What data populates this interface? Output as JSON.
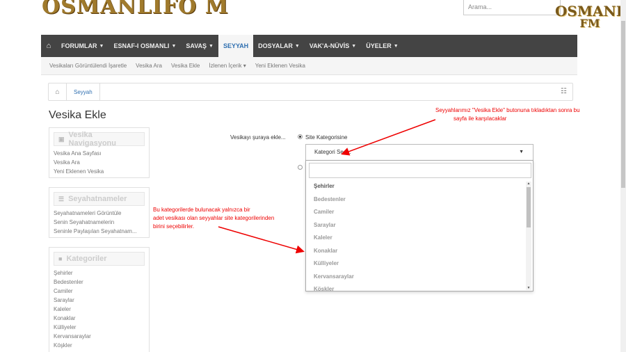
{
  "header": {
    "logo_text": "OSMANLIFO M",
    "search_placeholder": "Arama...",
    "fm_logo_line1": "OSMANLİ",
    "fm_logo_line2": "FM"
  },
  "nav": {
    "items": [
      {
        "label": "FORUMLAR",
        "caret": "▼"
      },
      {
        "label": "ESNAF-I OSMANLI",
        "caret": "▼"
      },
      {
        "label": "SAVAŞ",
        "caret": "▼"
      },
      {
        "label": "SEYYAH",
        "caret": ""
      },
      {
        "label": "DOSYALAR",
        "caret": "▼"
      },
      {
        "label": "VAK'A-NÜVİS",
        "caret": "▼"
      },
      {
        "label": "ÜYELER",
        "caret": "▼"
      }
    ],
    "active_index": 3
  },
  "subnav": {
    "items": [
      "Vesikaları Görüntülendi İşaretle",
      "Vesika Ara",
      "Vesika Ekle",
      "İzlenen İçerik ▾",
      "Yeni Eklenen Vesika"
    ]
  },
  "breadcrumb": {
    "current": "Seyyah"
  },
  "page": {
    "title": "Vesika Ekle"
  },
  "sidebar": {
    "panels": [
      {
        "title": "Vesika Navigasyonu",
        "icon": "compass-icon",
        "links": [
          "Vesika Ana Sayfası",
          "Vesika Ara",
          "Yeni Eklenen Vesika"
        ]
      },
      {
        "title": "Seyahatnameler",
        "icon": "list-icon",
        "links": [
          "Seyahatnameleri Görüntüle",
          "Senin Seyahatnamelerin",
          "Seninle Paylaşılan Seyahatnam..."
        ]
      },
      {
        "title": "Kategoriler",
        "icon": "folder-icon",
        "links": [
          "Şehirler",
          "Bedestenler",
          "Camiler",
          "Saraylar",
          "Kaleler",
          "Konaklar",
          "Külliyeler",
          "Kervansaraylar",
          "Köşkler"
        ]
      }
    ]
  },
  "form": {
    "label": "Vesikayı şuraya ekle...",
    "radio_label": "Site Kategorisine",
    "select_value": "Kategori Seç...",
    "options": [
      "Şehirler",
      "Bedestenler",
      "Camiler",
      "Saraylar",
      "Kaleler",
      "Konaklar",
      "Külliyeler",
      "Kervansaraylar",
      "Köşkler"
    ]
  },
  "annotations": {
    "top_line1": "Seyyahlarımız \"Vesika Ekle\" butonuna tıkladıktan sonra bu",
    "top_line2": "sayfa ile karşılacaklar",
    "left_line1": "Bu kategorilerde bulunacak yalnızca bir",
    "left_line2": "adet vesikası olan seyyahlar site kategorilerinden",
    "left_line3": "birini seçebilirler."
  },
  "colors": {
    "navbar_bg": "#444444",
    "active_link": "#2f6fb0",
    "annotation": "#ee0000"
  }
}
